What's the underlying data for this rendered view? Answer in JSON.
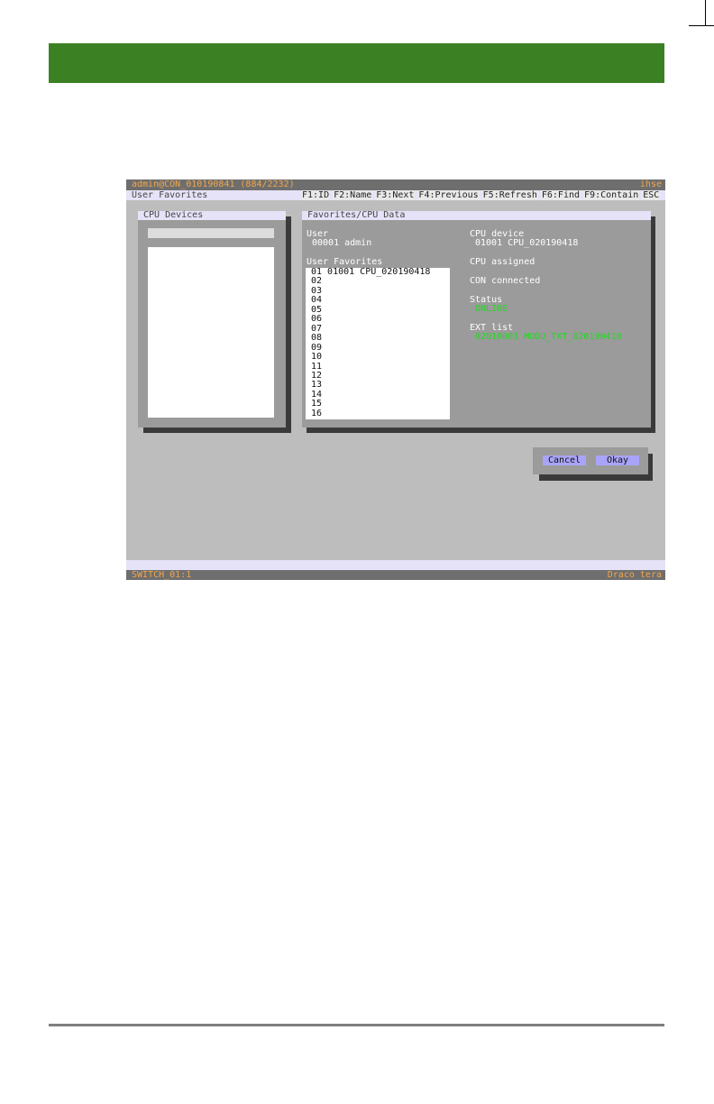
{
  "titlebar": {
    "session": "admin@CON_010190841 (884/2232)",
    "brand": "ihse"
  },
  "menubar": {
    "screen_title": "User Favorites",
    "fkeys": [
      "F1:ID",
      "F2:Name",
      "F3:Next",
      "F4:Previous",
      "F5:Refresh",
      "F6:Find",
      "F9:Contain",
      "ESC"
    ]
  },
  "cpu_devices": {
    "title": "CPU Devices"
  },
  "favorites": {
    "title": "Favorites/CPU Data",
    "user_label": "User",
    "user_value": "00001 admin",
    "list_label": "User Favorites",
    "rows": [
      "01 01001 CPU_020190418",
      "02",
      "03",
      "04",
      "05",
      "06",
      "07",
      "08",
      "09",
      "10",
      "11",
      "12",
      "13",
      "14",
      "15",
      "16"
    ],
    "cpu_device_label": "CPU device",
    "cpu_device_value": "01001 CPU_020190418",
    "cpu_assigned_label": "CPU assigned",
    "con_connected_label": "CON connected",
    "status_label": "Status",
    "status_value": "ONLINE",
    "ext_list_label": "EXT list",
    "ext_list_value": "02010003 MODU_TXT_020190418"
  },
  "buttons": {
    "cancel": "Cancel",
    "okay": "Okay"
  },
  "bottombar": {
    "left": "SWITCH_01:1",
    "right": "Draco tera"
  }
}
